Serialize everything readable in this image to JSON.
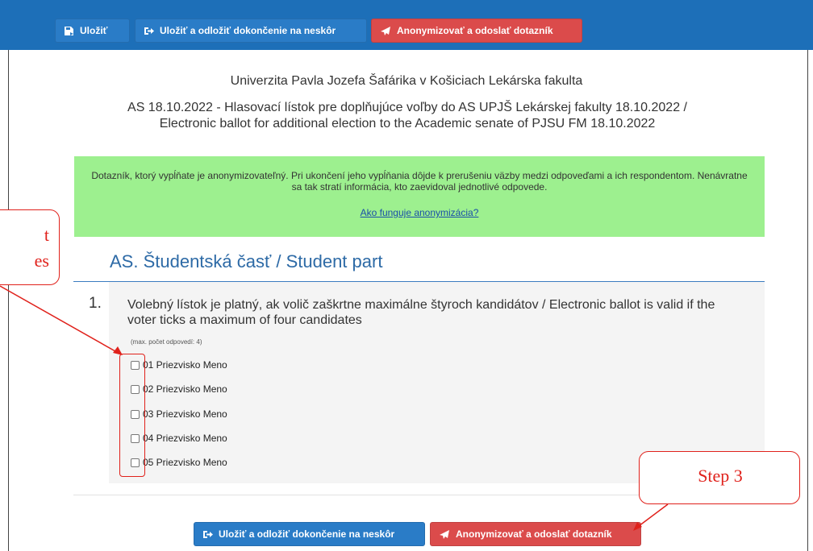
{
  "toolbar": {
    "save_label": "Uložiť",
    "save_later_label": "Uložiť a odložiť dokončenie na neskôr",
    "anonymize_send_label": "Anonymizovať a odoslať dotazník"
  },
  "header": {
    "university": "Univerzita Pavla Jozefa Šafárika v Košiciach Lekárska fakulta",
    "survey_title_line1": "AS 18.10.2022 - Hlasovací lístok pre doplňujúce voľby do AS UPJŠ Lekárskej fakulty 18.10.2022 /",
    "survey_title_line2": "Electronic ballot for additional election to the Academic senate of PJSU FM 18.10.2022"
  },
  "notice": {
    "text": "Dotazník, ktorý vypĺňate je anonymizovateľný. Pri ukončení jeho vypĺňania dôjde k prerušeniu väzby medzi odpoveďami a ich respondentom. Nenávratne sa tak stratí informácia, kto zaevidoval jednotlivé odpovede.",
    "link": "Ako funguje anonymizácia?"
  },
  "section": {
    "title": "AS. Študentská časť / Student part"
  },
  "question": {
    "number": "1.",
    "text": "Volebný lístok je platný, ak volič zaškrtne maximálne štyroch kandidátov / Electronic ballot is valid if the voter ticks a maximum of four candidates",
    "max_note": "(max. počet odpovedí: 4)",
    "options": [
      "01 Priezvisko Meno",
      "02 Priezvisko Meno",
      "03 Priezvisko Meno",
      "04 Priezvisko Meno",
      "05 Priezvisko Meno"
    ]
  },
  "bottom_buttons": {
    "save_later_label": "Uložiť a odložiť dokončenie na neskôr",
    "anonymize_send_label": "Anonymizovať a odoslať dotazník"
  },
  "annotations": {
    "left_callout_line1": "t",
    "left_callout_line2": "es",
    "right_callout": "Step 3"
  },
  "colors": {
    "toolbar_bg": "#1d6fb8",
    "button_blue": "#2a7cc7",
    "button_red": "#db4b4b",
    "notice_bg": "#9df08f",
    "section_title": "#2d6aa6",
    "annotation_red": "#e0211b"
  }
}
